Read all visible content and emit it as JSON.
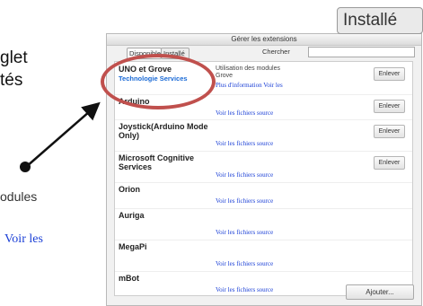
{
  "annotation_text": {
    "line1": "glet",
    "line2": "tés",
    "line3": "odules",
    "line4": "Voir les"
  },
  "zoom_badge": "Installé",
  "dialog": {
    "title": "Gérer les extensions",
    "tabs": [
      "Disponible",
      "Installé"
    ],
    "search_label": "Chercher",
    "search_value": "",
    "add_label": "Ajouter...",
    "extensions": [
      {
        "name": "UNO et Grove",
        "subtitle": "Technologie Services",
        "desc": "Utilisation des modules Grove",
        "links": "Plus d'information   Voir les",
        "action": "Enlever"
      },
      {
        "name": "Arduino",
        "subtitle": "",
        "desc": "",
        "links": "Voir les fichiers source",
        "action": "Enlever"
      },
      {
        "name": "Joystick(Arduino Mode Only)",
        "subtitle": "",
        "desc": "",
        "links": "Voir les fichiers source",
        "action": "Enlever"
      },
      {
        "name": "Microsoft Cognitive Services",
        "subtitle": "",
        "desc": "",
        "links": "Voir les fichiers source",
        "action": "Enlever"
      },
      {
        "name": "Orion",
        "subtitle": "",
        "desc": "",
        "links": "Voir les fichiers source",
        "action": ""
      },
      {
        "name": "Auriga",
        "subtitle": "",
        "desc": "",
        "links": "Voir les fichiers source",
        "action": ""
      },
      {
        "name": "MegaPi",
        "subtitle": "",
        "desc": "",
        "links": "Voir les fichiers source",
        "action": ""
      },
      {
        "name": "mBot",
        "subtitle": "",
        "desc": "",
        "links": "Voir les fichiers source",
        "action": ""
      }
    ]
  },
  "colors": {
    "callout": "#c0504d",
    "link": "#1a3fd6",
    "highlight_text": "#1a6ad6"
  }
}
